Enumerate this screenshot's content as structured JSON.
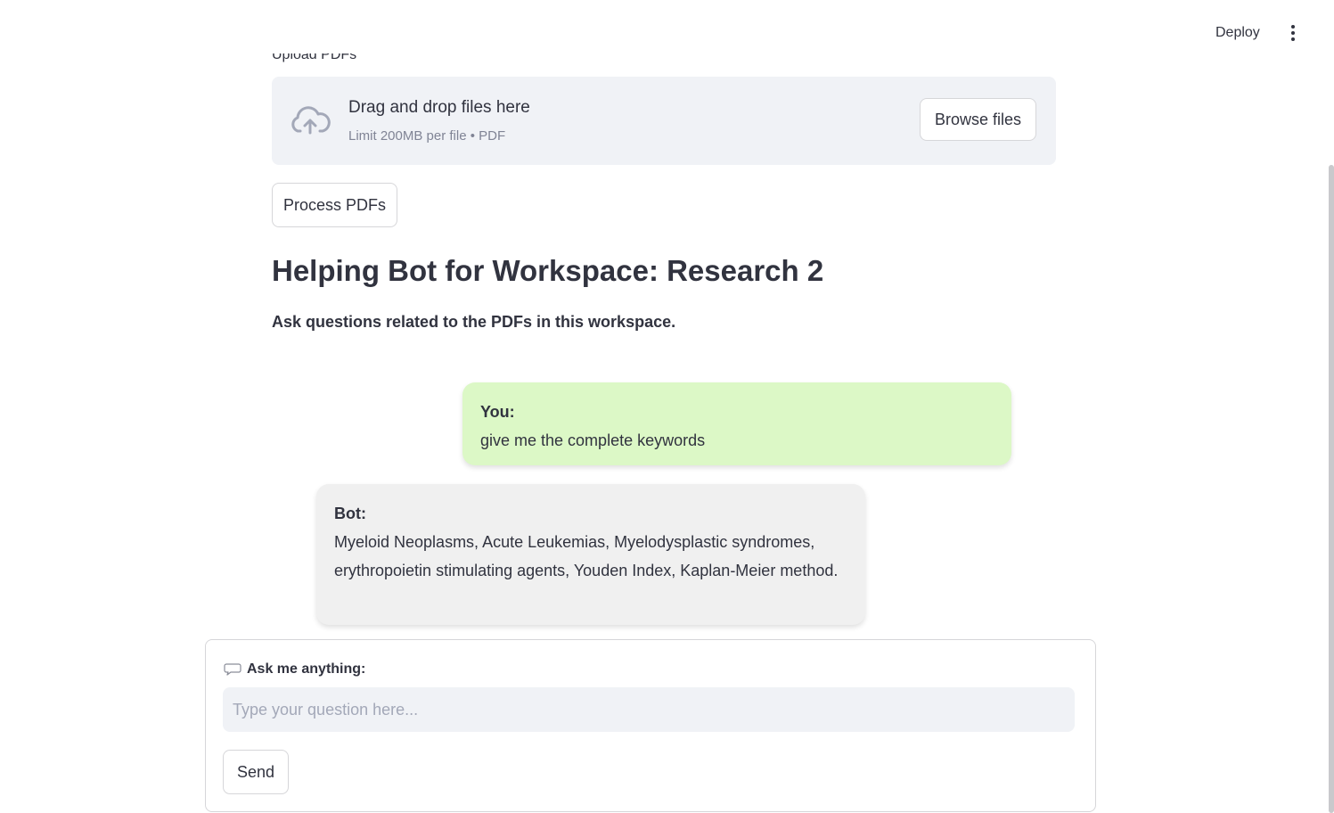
{
  "header": {
    "deploy_label": "Deploy",
    "menu_icon": "kebab-menu-icon"
  },
  "uploader": {
    "label": "Upload PDFs",
    "drop_title": "Drag and drop files here",
    "drop_limit": "Limit 200MB per file • PDF",
    "browse_label": "Browse files",
    "icon": "cloud-upload-icon"
  },
  "process_label": "Process PDFs",
  "page": {
    "title": "Helping Bot for Workspace: Research 2",
    "subtitle": "Ask questions related to the PDFs in this workspace."
  },
  "chat": {
    "messages": [
      {
        "sender": "You:",
        "text": "give me the complete keywords",
        "color": "#dcf8c6"
      },
      {
        "sender": "Bot:",
        "text": "Myeloid Neoplasms, Acute Leukemias, Myelodysplastic syndromes, erythropoietin stimulating agents, Youden Index, Kaplan-Meier method.",
        "color": "#f0f0f0"
      }
    ]
  },
  "form": {
    "label": "Ask me anything:",
    "label_icon": "speech-bubble-icon",
    "input_value": "",
    "input_placeholder": "Type your question here...",
    "send_label": "Send"
  },
  "colors": {
    "panel_bg": "#f0f2f6",
    "text": "#31333f",
    "border": "#d6d6d9"
  }
}
